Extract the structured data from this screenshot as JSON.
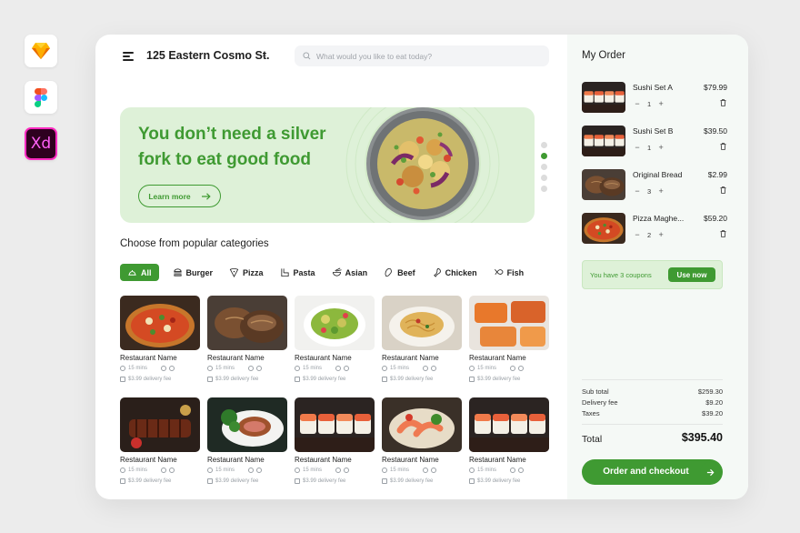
{
  "header": {
    "address": "125 Eastern Cosmo St.",
    "search_placeholder": "What would you like to eat today?"
  },
  "hero": {
    "title": "You don’t need a silver fork to eat good food",
    "button_label": "Learn more",
    "slide_count": 5,
    "active_slide": 2
  },
  "categories": {
    "title": "Choose from popular categories",
    "items": [
      {
        "label": "All",
        "icon": "cloche-icon",
        "active": true
      },
      {
        "label": "Burger",
        "icon": "burger-icon",
        "active": false
      },
      {
        "label": "Pizza",
        "icon": "pizza-icon",
        "active": false
      },
      {
        "label": "Pasta",
        "icon": "pasta-icon",
        "active": false
      },
      {
        "label": "Asian",
        "icon": "bowl-icon",
        "active": false
      },
      {
        "label": "Beef",
        "icon": "beef-icon",
        "active": false
      },
      {
        "label": "Chicken",
        "icon": "chicken-icon",
        "active": false
      },
      {
        "label": "Fish",
        "icon": "fish-icon",
        "active": false
      }
    ]
  },
  "restaurants": [
    {
      "name": "Restaurant Name",
      "time": "15 mins",
      "fee": "$3.99 delivery fee",
      "food": "pizza"
    },
    {
      "name": "Restaurant Name",
      "time": "15 mins",
      "fee": "$3.99 delivery fee",
      "food": "bread"
    },
    {
      "name": "Restaurant Name",
      "time": "15 mins",
      "fee": "$3.99 delivery fee",
      "food": "salad"
    },
    {
      "name": "Restaurant Name",
      "time": "15 mins",
      "fee": "$3.99 delivery fee",
      "food": "pasta"
    },
    {
      "name": "Restaurant Name",
      "time": "15 mins",
      "fee": "$3.99 delivery fee",
      "food": "chicken"
    },
    {
      "name": "Restaurant Name",
      "time": "15 mins",
      "fee": "$3.99 delivery fee",
      "food": "ribs"
    },
    {
      "name": "Restaurant Name",
      "time": "15 mins",
      "fee": "$3.99 delivery fee",
      "food": "steak"
    },
    {
      "name": "Restaurant Name",
      "time": "15 mins",
      "fee": "$3.99 delivery fee",
      "food": "sushi"
    },
    {
      "name": "Restaurant Name",
      "time": "15 mins",
      "fee": "$3.99 delivery fee",
      "food": "sashimi"
    },
    {
      "name": "Restaurant Name",
      "time": "15 mins",
      "fee": "$3.99 delivery fee",
      "food": "sushi"
    }
  ],
  "order": {
    "title": "My Order",
    "items": [
      {
        "name": "Sushi Set A",
        "price": "$79.99",
        "qty": "1",
        "food": "sushi"
      },
      {
        "name": "Sushi Set B",
        "price": "$39.50",
        "qty": "1",
        "food": "sushi"
      },
      {
        "name": "Original Bread",
        "price": "$2.99",
        "qty": "3",
        "food": "bread"
      },
      {
        "name": "Pizza Maghe...",
        "price": "$59.20",
        "qty": "2",
        "food": "pizza"
      }
    ],
    "coupon_text": "You have 3 coupons",
    "coupon_button": "Use now",
    "subtotal_label": "Sub total",
    "subtotal": "$259.30",
    "delivery_label": "Delivery fee",
    "delivery": "$9.20",
    "taxes_label": "Taxes",
    "taxes": "$39.20",
    "total_label": "Total",
    "total": "$395.40",
    "checkout_label": "Order and checkout"
  },
  "colors": {
    "accent": "#3f9a32",
    "hero_bg": "#def1d8",
    "order_bg": "#f5f9f6"
  }
}
